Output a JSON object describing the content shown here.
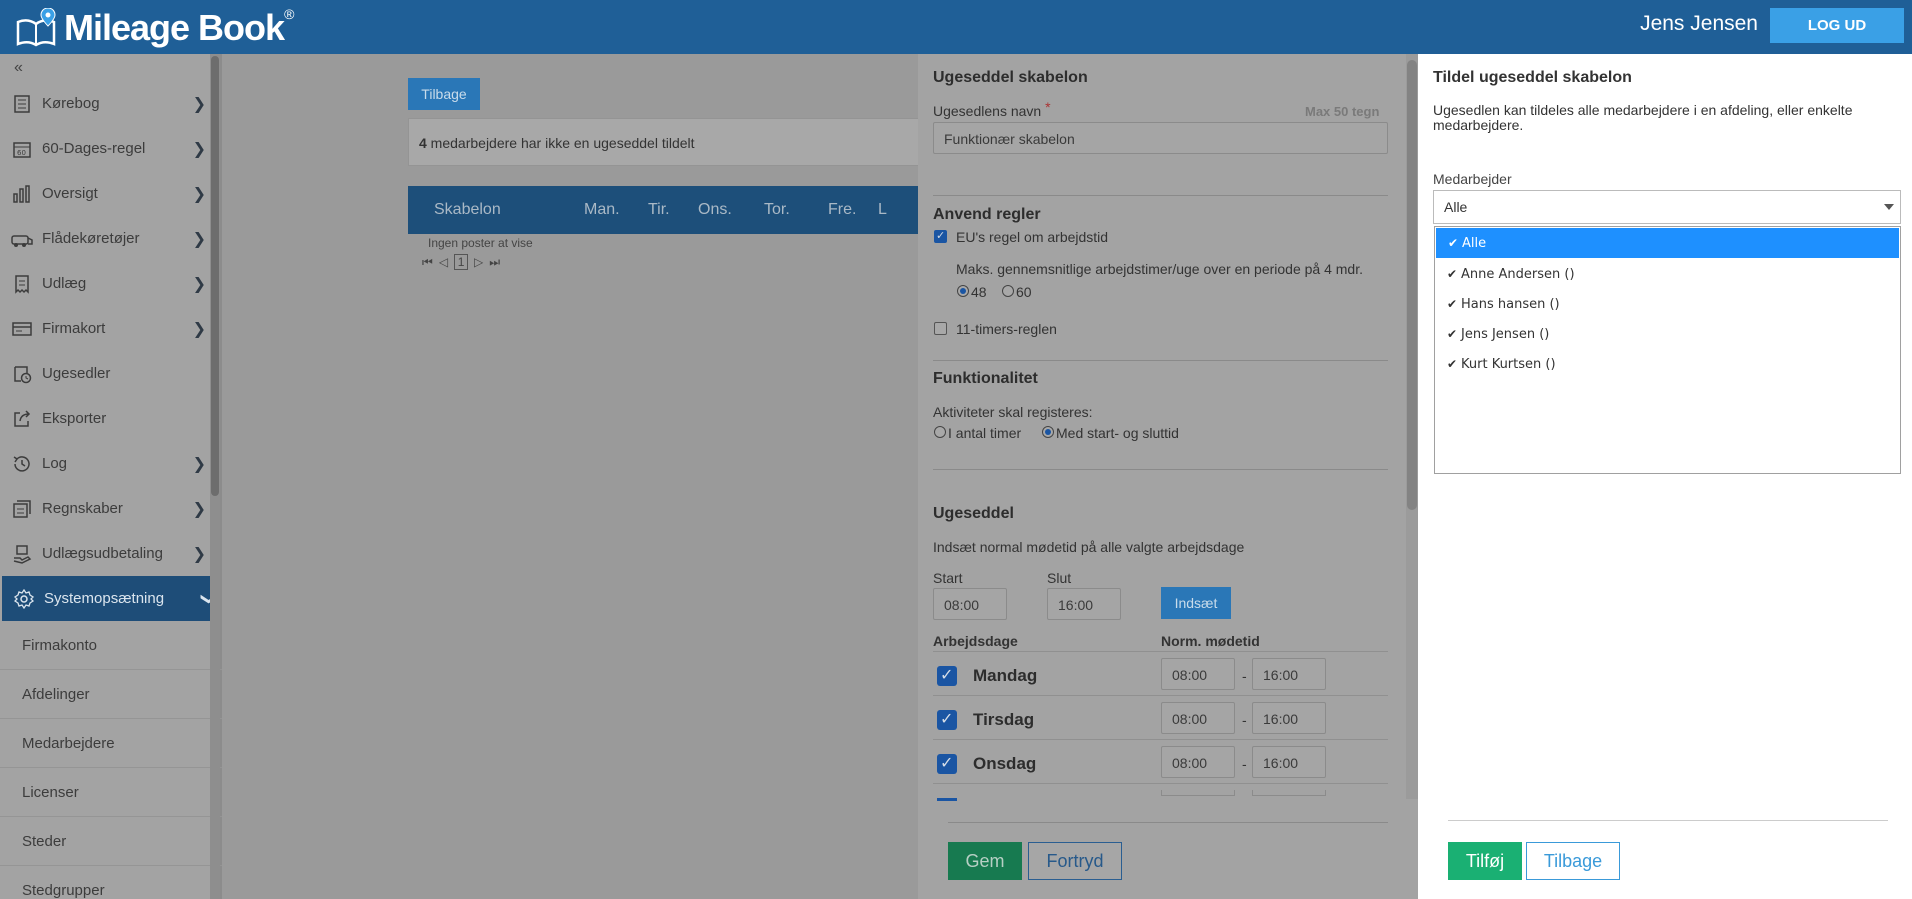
{
  "header": {
    "app_name": "Mileage Book",
    "registered": "®",
    "user_name": "Jens Jensen",
    "logout_label": "LOG UD"
  },
  "sidebar": {
    "collapse_glyph": "«",
    "items": [
      {
        "label": "Kørebog",
        "icon": "logbook-icon"
      },
      {
        "label": "60-Dages-regel",
        "icon": "calendar-60-icon"
      },
      {
        "label": "Oversigt",
        "icon": "bar-chart-icon"
      },
      {
        "label": "Flådekøretøjer",
        "icon": "vehicle-fleet-icon"
      },
      {
        "label": "Udlæg",
        "icon": "receipt-icon"
      },
      {
        "label": "Firmakort",
        "icon": "card-icon"
      },
      {
        "label": "Ugesedler",
        "icon": "timesheet-icon"
      },
      {
        "label": "Eksporter",
        "icon": "export-icon"
      },
      {
        "label": "Log",
        "icon": "history-icon"
      },
      {
        "label": "Regnskaber",
        "icon": "accounts-icon"
      },
      {
        "label": "Udlægsudbetaling",
        "icon": "payout-icon"
      }
    ],
    "active_item": {
      "label": "Systemopsætning",
      "icon": "gear-icon"
    },
    "sub_items": [
      "Firmakonto",
      "Afdelinger",
      "Medarbejdere",
      "Licenser",
      "Steder",
      "Stedgrupper"
    ]
  },
  "main": {
    "back_label": "Tilbage",
    "info_count": "4",
    "info_text": " medarbejdere har ikke en ugeseddel tildelt",
    "columns": [
      "Skabelon",
      "Man.",
      "Tir.",
      "Ons.",
      "Tor.",
      "Fre.",
      "L"
    ],
    "no_posts": "Ingen poster at vise",
    "page_current": "1"
  },
  "template": {
    "title": "Ugeseddel skabelon",
    "name_label": "Ugesedlens navn",
    "required_mark": "*",
    "max_hint": "Max 50 tegn",
    "name_value": "Funktionær skabelon",
    "rules_title": "Anvend regler",
    "eu_rule_label": "EU's regel om arbejdstid",
    "max_hours_text": "Maks. gennemsnitlige arbejdstimer/uge over en periode på 4 mdr.",
    "radio_48": "48",
    "radio_60": "60",
    "rule_11_label": "11-timers-reglen",
    "func_title": "Funktionalitet",
    "activities_label": "Aktiviteter skal registeres:",
    "opt_hours": "I antal timer",
    "opt_startend": "Med start- og sluttid",
    "week_title": "Ugeseddel",
    "insert_hint": "Indsæt normal mødetid på alle valgte arbejdsdage",
    "start_label": "Start",
    "end_label": "Slut",
    "start_value": "08:00",
    "end_value": "16:00",
    "insert_button": "Indsæt",
    "col_workdays": "Arbejdsdage",
    "col_normtime": "Norm. mødetid",
    "days": [
      {
        "name": "Mandag",
        "from": "08:00",
        "to": "16:00"
      },
      {
        "name": "Tirsdag",
        "from": "08:00",
        "to": "16:00"
      },
      {
        "name": "Onsdag",
        "from": "08:00",
        "to": "16:00"
      }
    ],
    "dash": "-",
    "save_label": "Gem",
    "cancel_label": "Fortryd"
  },
  "assign": {
    "title": "Tildel ugeseddel skabelon",
    "description": "Ugesedlen kan tildeles alle medarbejdere i en afdeling, eller enkelte medarbejdere.",
    "employee_label": "Medarbejder",
    "selected": "Alle",
    "options": [
      "Alle",
      "Anne Andersen ()",
      "Hans hansen ()",
      "Jens Jensen ()",
      "Kurt Kurtsen ()"
    ],
    "add_label": "Tilføj",
    "back_label": "Tilbage"
  }
}
